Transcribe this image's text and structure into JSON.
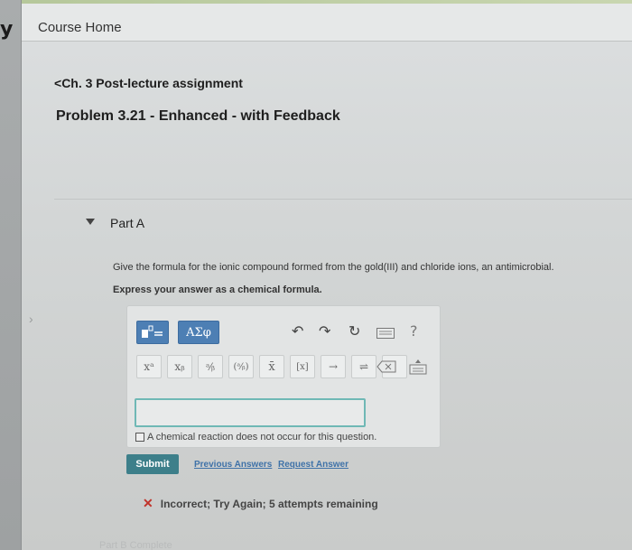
{
  "header": {
    "logo": "y",
    "course_home": "Course Home"
  },
  "breadcrumb": {
    "back_label": "Ch. 3 Post-lecture assignment"
  },
  "problem": {
    "title": "Problem 3.21 - Enhanced - with Feedback"
  },
  "part": {
    "label": "Part A"
  },
  "question": {
    "text": "Give the formula for the ionic compound formed from the gold(III) and chloride ions, an antimicrobial.",
    "instruction": "Express your answer as a chemical formula."
  },
  "toolbar": {
    "greek_label": "ΑΣφ",
    "help_label": "?",
    "superscript": "xᵃ",
    "subscript": "xᵦ",
    "fraction": "ᵃ⁄ᵦ",
    "frac_paren": "(ᵃ⁄ᵦ)",
    "overline": "x̄",
    "bracket": "[x]",
    "arrow": "→",
    "equilibrium": "⇌",
    "dot": "•"
  },
  "answer": {
    "value": "",
    "no_reaction_label": "A chemical reaction does not occur for this question."
  },
  "actions": {
    "submit": "Submit",
    "previous_answers": "Previous Answers",
    "request_answer": "Request Answer"
  },
  "feedback": {
    "mark": "✕",
    "text": "Incorrect; Try Again; 5 attempts remaining"
  },
  "footer": {
    "text": "Part B Complete"
  },
  "colors": {
    "submit_bg": "#3d7f8a",
    "link": "#3f72a8",
    "error": "#c0332b",
    "template_btn": "#4d7fb4",
    "input_border": "#6fb8b5"
  },
  "icons": [
    "templates-icon",
    "undo-icon",
    "redo-icon",
    "reset-icon",
    "keyboard-icon",
    "help-icon",
    "delete-icon",
    "keypad-icon"
  ]
}
